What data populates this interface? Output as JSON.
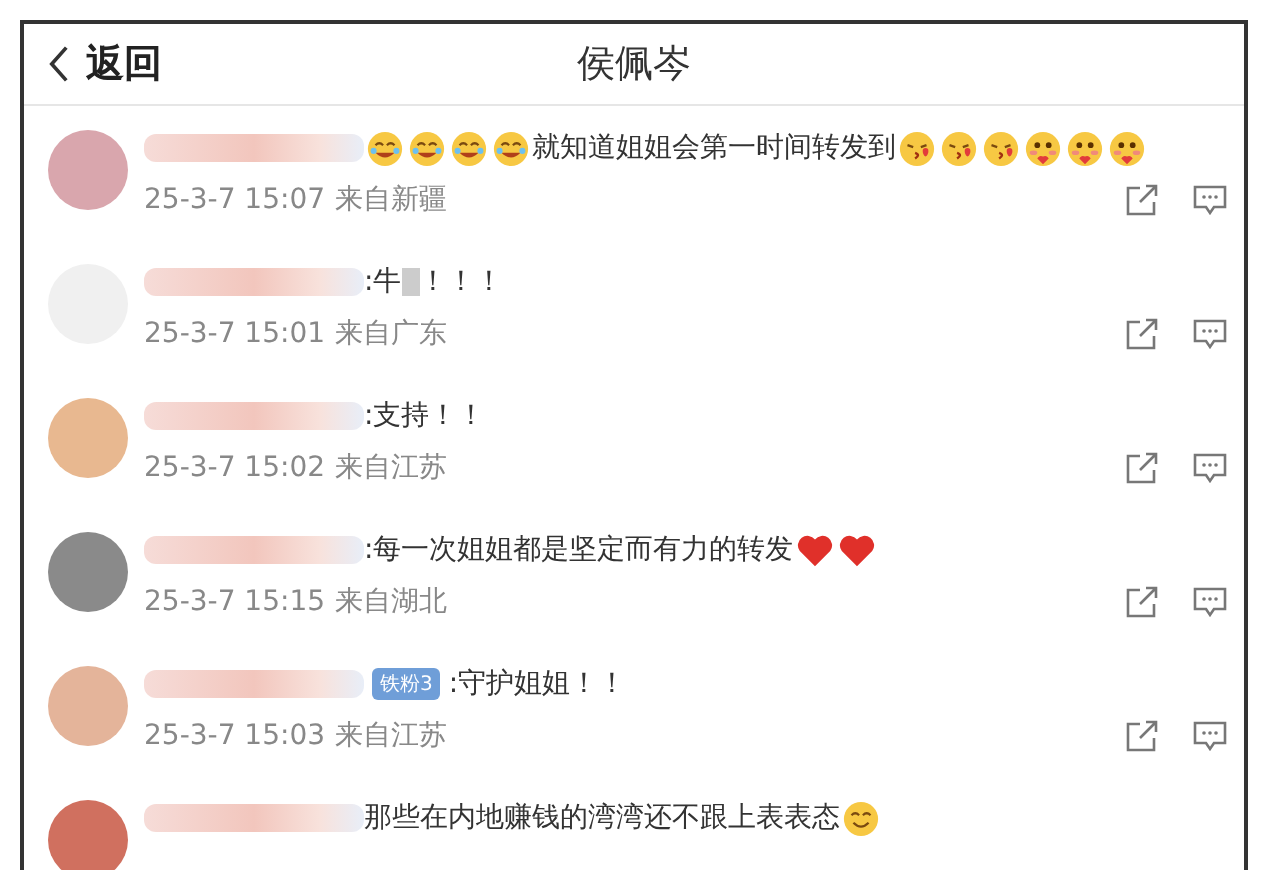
{
  "header": {
    "back_label": "返回",
    "title": "侯佩岑"
  },
  "comments": [
    {
      "avatar": {
        "color": "#d9a6ad"
      },
      "segments": [
        {
          "kind": "blur"
        },
        {
          "kind": "laugh"
        },
        {
          "kind": "laugh"
        },
        {
          "kind": "laugh"
        },
        {
          "kind": "laugh"
        },
        {
          "kind": "text",
          "text": "就知道姐姐会第一时间转发到"
        },
        {
          "kind": "kiss"
        },
        {
          "kind": "kiss"
        },
        {
          "kind": "kiss"
        },
        {
          "kind": "love"
        },
        {
          "kind": "love"
        },
        {
          "kind": "love"
        }
      ],
      "time": "25-3-7 15:07",
      "source": "来自新疆"
    },
    {
      "avatar": {
        "color": "#f0f0f0"
      },
      "segments": [
        {
          "kind": "blur"
        },
        {
          "kind": "text",
          "text": ":牛"
        },
        {
          "kind": "blur-char"
        },
        {
          "kind": "text",
          "text": "！！！"
        }
      ],
      "time": "25-3-7 15:01",
      "source": "来自广东"
    },
    {
      "avatar": {
        "color": "#e8b890"
      },
      "segments": [
        {
          "kind": "blur"
        },
        {
          "kind": "text",
          "text": ":支持！！"
        }
      ],
      "time": "25-3-7 15:02",
      "source": "来自江苏"
    },
    {
      "avatar": {
        "color": "#8a8a8a"
      },
      "segments": [
        {
          "kind": "blur"
        },
        {
          "kind": "text",
          "text": ":每一次姐姐都是坚定而有力的转发"
        },
        {
          "kind": "heart"
        },
        {
          "kind": "heart"
        }
      ],
      "time": "25-3-7 15:15",
      "source": "来自湖北"
    },
    {
      "avatar": {
        "color": "#e4b49a"
      },
      "segments": [
        {
          "kind": "blur"
        },
        {
          "kind": "badge",
          "text": "铁粉3"
        },
        {
          "kind": "text",
          "text": ":守护姐姐！！"
        }
      ],
      "time": "25-3-7 15:03",
      "source": "来自江苏"
    },
    {
      "avatar": {
        "color": "#d0705f"
      },
      "segments": [
        {
          "kind": "blur"
        },
        {
          "kind": "text",
          "text": "那些在内地赚钱的湾湾还不跟上表表态"
        },
        {
          "kind": "smile"
        }
      ]
    }
  ]
}
